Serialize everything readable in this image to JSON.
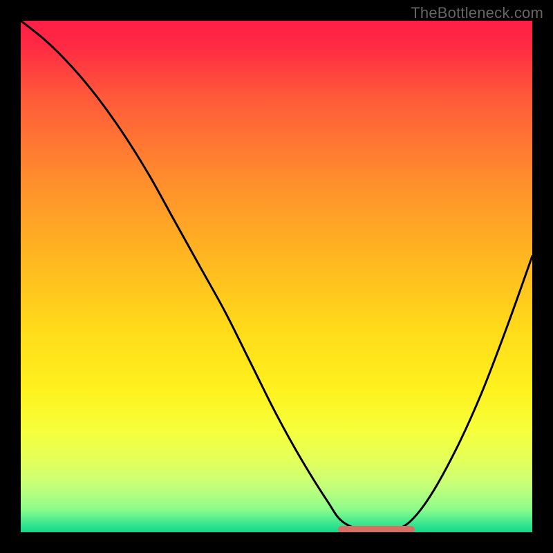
{
  "watermark": "TheBottleneck.com",
  "chart_data": {
    "type": "line",
    "title": "",
    "xlabel": "",
    "ylabel": "",
    "xlim": [
      0,
      100
    ],
    "ylim": [
      0,
      100
    ],
    "grid": false,
    "legend": false,
    "series": [
      {
        "name": "bottleneck-curve",
        "x": [
          0,
          5,
          10,
          15,
          20,
          25,
          30,
          35,
          40,
          45,
          50,
          55,
          60,
          63,
          68,
          72,
          76,
          80,
          85,
          90,
          95,
          100
        ],
        "values": [
          100,
          96,
          91,
          85,
          78,
          70,
          61,
          52,
          43,
          33,
          23,
          14,
          6,
          2,
          0,
          0,
          2,
          7,
          16,
          27,
          40,
          54
        ]
      }
    ],
    "annotations": [
      {
        "name": "optimal-range-marker",
        "x_start": 62,
        "x_end": 77,
        "y": 0.5,
        "color": "#d67062"
      }
    ],
    "background_gradient": {
      "stops": [
        {
          "pos": 0.0,
          "color": "#ff1e46"
        },
        {
          "pos": 0.05,
          "color": "#ff2a44"
        },
        {
          "pos": 0.15,
          "color": "#ff5a3a"
        },
        {
          "pos": 0.3,
          "color": "#ff8a2e"
        },
        {
          "pos": 0.45,
          "color": "#ffb321"
        },
        {
          "pos": 0.6,
          "color": "#ffda1a"
        },
        {
          "pos": 0.72,
          "color": "#fff11e"
        },
        {
          "pos": 0.8,
          "color": "#f6ff3a"
        },
        {
          "pos": 0.86,
          "color": "#e4ff5a"
        },
        {
          "pos": 0.91,
          "color": "#c4ff7a"
        },
        {
          "pos": 0.955,
          "color": "#8dfc8a"
        },
        {
          "pos": 0.985,
          "color": "#34e58f"
        },
        {
          "pos": 1.0,
          "color": "#16d889"
        }
      ]
    }
  }
}
